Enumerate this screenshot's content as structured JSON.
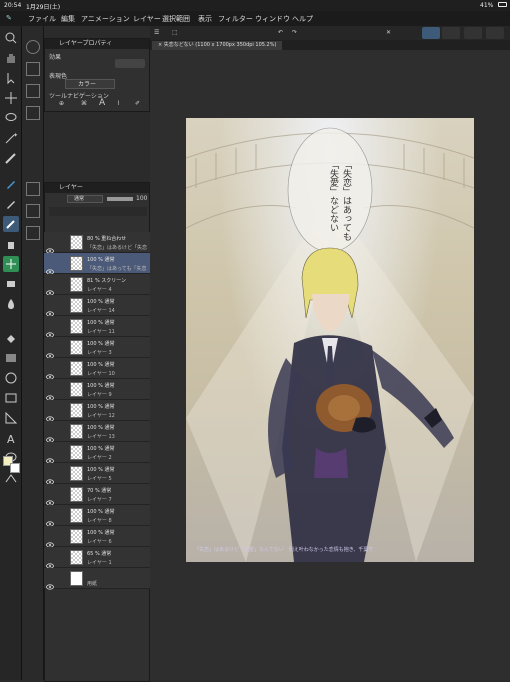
{
  "status_bar": {
    "time": "20:54",
    "date": "1月29日(土)",
    "battery": "41%"
  },
  "menu": {
    "items": [
      "ファイル",
      "編集",
      "アニメーション",
      "レイヤー",
      "選択範囲",
      "表示",
      "フィルター",
      "ウィンドウ",
      "ヘルプ"
    ]
  },
  "document_tab": {
    "title": "失恋などない (1100 x 1700px 350dpi 105.2%)"
  },
  "layer_property_panel": {
    "title": "レイヤープロパティ",
    "effect_label": "効果",
    "color_label": "表現色",
    "color_value": "カラー",
    "tool_nav_label": "ツールナビゲーション"
  },
  "layer_panel": {
    "title": "レイヤー",
    "blend_mode": "通常",
    "opacity": "100",
    "layers": [
      {
        "mode": "80 % 重ね合わせ",
        "name": "「失恋」はあるけど「失恋",
        "selected": false
      },
      {
        "mode": "100 % 通常",
        "name": "「失恋」はあっても「失恋",
        "selected": true
      },
      {
        "mode": "81 % スクリーン",
        "name": "レイヤー 4",
        "selected": false
      },
      {
        "mode": "100 % 通常",
        "name": "レイヤー 14",
        "selected": false
      },
      {
        "mode": "100 % 通常",
        "name": "レイヤー 11",
        "selected": false
      },
      {
        "mode": "100 % 通常",
        "name": "レイヤー 3",
        "selected": false
      },
      {
        "mode": "100 % 通常",
        "name": "レイヤー 10",
        "selected": false
      },
      {
        "mode": "100 % 通常",
        "name": "レイヤー 9",
        "selected": false
      },
      {
        "mode": "100 % 通常",
        "name": "レイヤー 12",
        "selected": false
      },
      {
        "mode": "100 % 通常",
        "name": "レイヤー 13",
        "selected": false
      },
      {
        "mode": "100 % 通常",
        "name": "レイヤー 2",
        "selected": false
      },
      {
        "mode": "100 % 通常",
        "name": "レイヤー 5",
        "selected": false
      },
      {
        "mode": "70 % 通常",
        "name": "レイヤー 7",
        "selected": false
      },
      {
        "mode": "100 % 通常",
        "name": "レイヤー 8",
        "selected": false
      },
      {
        "mode": "100 % 通常",
        "name": "レイヤー 6",
        "selected": false
      },
      {
        "mode": "65 % 通常",
        "name": "レイヤー 1",
        "selected": false
      },
      {
        "mode": "",
        "name": "用紙",
        "selected": false
      }
    ]
  },
  "artwork": {
    "speech_text": "「失恋」はあっても「失愛」などない",
    "caption": "「失恋」はあるけど「失愛」なんてない　例え叶わなかった恋情も抱き、千葉で"
  },
  "colors": {
    "accent": "#3d5a78",
    "selected_layer": "#4b5a78",
    "panel": "#303030"
  }
}
